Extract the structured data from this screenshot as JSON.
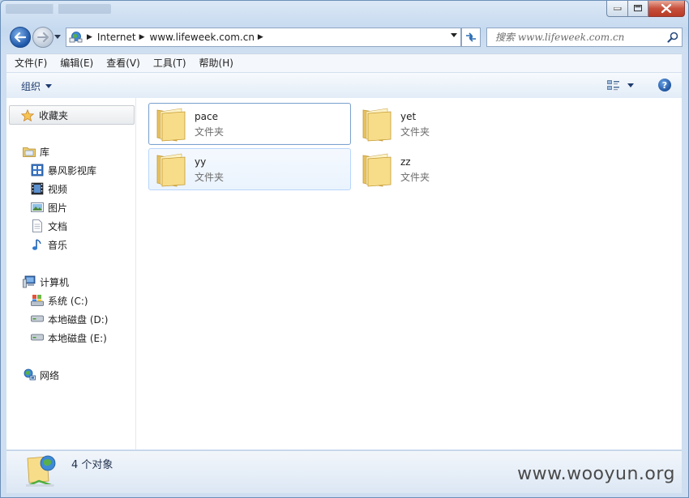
{
  "window": {
    "controls": {
      "minimize_icon": "minimize-icon",
      "maximize_icon": "maximize-icon",
      "close_icon": "close-icon"
    }
  },
  "address": {
    "crumbs": [
      "Internet",
      "www.lifeweek.com.cn"
    ],
    "location_icon": "network-location-icon"
  },
  "search": {
    "placeholder": "搜索 www.lifeweek.com.cn"
  },
  "menu": {
    "items": [
      "文件(F)",
      "编辑(E)",
      "查看(V)",
      "工具(T)",
      "帮助(H)"
    ]
  },
  "toolbar": {
    "organize_label": "组织",
    "help_label": "?"
  },
  "sidebar": {
    "favorites": "收藏夹",
    "libraries": {
      "label": "库",
      "items": [
        "暴风影视库",
        "视频",
        "图片",
        "文档",
        "音乐"
      ]
    },
    "computer": {
      "label": "计算机",
      "items": [
        "系统 (C:)",
        "本地磁盘 (D:)",
        "本地磁盘 (E:)"
      ]
    },
    "network": "网络"
  },
  "files": [
    {
      "name": "pace",
      "type": "文件夹",
      "state": "selected"
    },
    {
      "name": "yet",
      "type": "文件夹",
      "state": "normal"
    },
    {
      "name": "yy",
      "type": "文件夹",
      "state": "hover"
    },
    {
      "name": "zz",
      "type": "文件夹",
      "state": "normal"
    }
  ],
  "status": {
    "count_text": "4 个对象"
  },
  "watermark": "www.wooyun.org",
  "colors": {
    "accent": "#3a6ea5",
    "selection_border": "#7da2ce",
    "hover_border": "#b8d6fb",
    "folder": "#f2d27a"
  }
}
